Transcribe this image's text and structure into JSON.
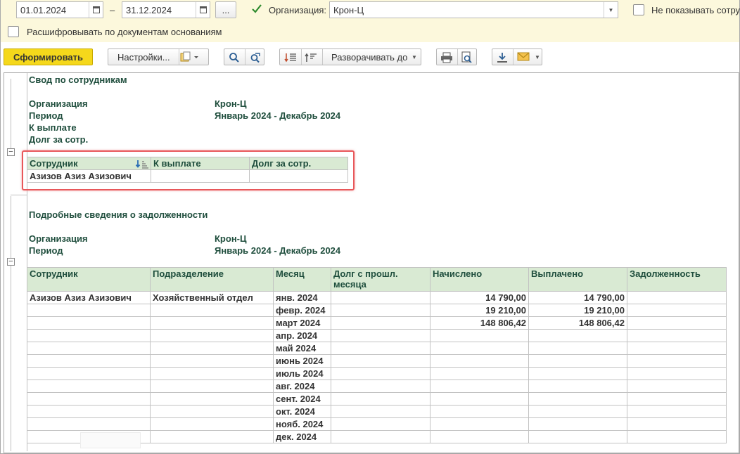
{
  "filters": {
    "date_from": "01.01.2024",
    "date_to": "31.12.2024",
    "date_sep": "–",
    "more_btn": "...",
    "org_checked": true,
    "org_label": "Организация:",
    "org_value": "Крон-Ц",
    "hide_emp_label": "Не показывать сотру",
    "decode_label": "Расшифровывать по документам основаниям"
  },
  "toolbar": {
    "generate": "Сформировать",
    "settings": "Настройки...",
    "expand": "Разворачивать до"
  },
  "summary": {
    "title": "Свод по сотрудникам",
    "org_label": "Организация",
    "org_value": "Крон-Ц",
    "period_label": "Период",
    "period_value": "Январь 2024 - Декабрь 2024",
    "pay_label": "К выплате",
    "debt_label": "Долг за сотр.",
    "table": {
      "headers": [
        "Сотрудник",
        "К выплате",
        "Долг за сотр."
      ],
      "rows": [
        [
          "Азизов Азиз Азизович",
          "",
          ""
        ]
      ]
    }
  },
  "details": {
    "title": "Подробные сведения о задолженности",
    "org_label": "Организация",
    "org_value": "Крон-Ц",
    "period_label": "Период",
    "period_value": "Январь 2024 - Декабрь 2024",
    "table": {
      "headers": [
        "Сотрудник",
        "Подразделение",
        "Месяц",
        "Долг с прошл. месяца",
        "Начислено",
        "Выплачено",
        "Задолженность"
      ],
      "rows": [
        [
          "Азизов Азиз Азизович",
          "Хозяйственный отдел",
          "янв. 2024",
          "",
          "14 790,00",
          "14 790,00",
          ""
        ],
        [
          "",
          "",
          "февр. 2024",
          "",
          "19 210,00",
          "19 210,00",
          ""
        ],
        [
          "",
          "",
          "март 2024",
          "",
          "148 806,42",
          "148 806,42",
          ""
        ],
        [
          "",
          "",
          "апр. 2024",
          "",
          "",
          "",
          ""
        ],
        [
          "",
          "",
          "май 2024",
          "",
          "",
          "",
          ""
        ],
        [
          "",
          "",
          "июнь 2024",
          "",
          "",
          "",
          ""
        ],
        [
          "",
          "",
          "июль 2024",
          "",
          "",
          "",
          ""
        ],
        [
          "",
          "",
          "авг. 2024",
          "",
          "",
          "",
          ""
        ],
        [
          "",
          "",
          "сент. 2024",
          "",
          "",
          "",
          ""
        ],
        [
          "",
          "",
          "окт. 2024",
          "",
          "",
          "",
          ""
        ],
        [
          "",
          "",
          "нояб. 2024",
          "",
          "",
          "",
          ""
        ],
        [
          "",
          "",
          "дек. 2024",
          "",
          "",
          "",
          ""
        ]
      ]
    }
  }
}
